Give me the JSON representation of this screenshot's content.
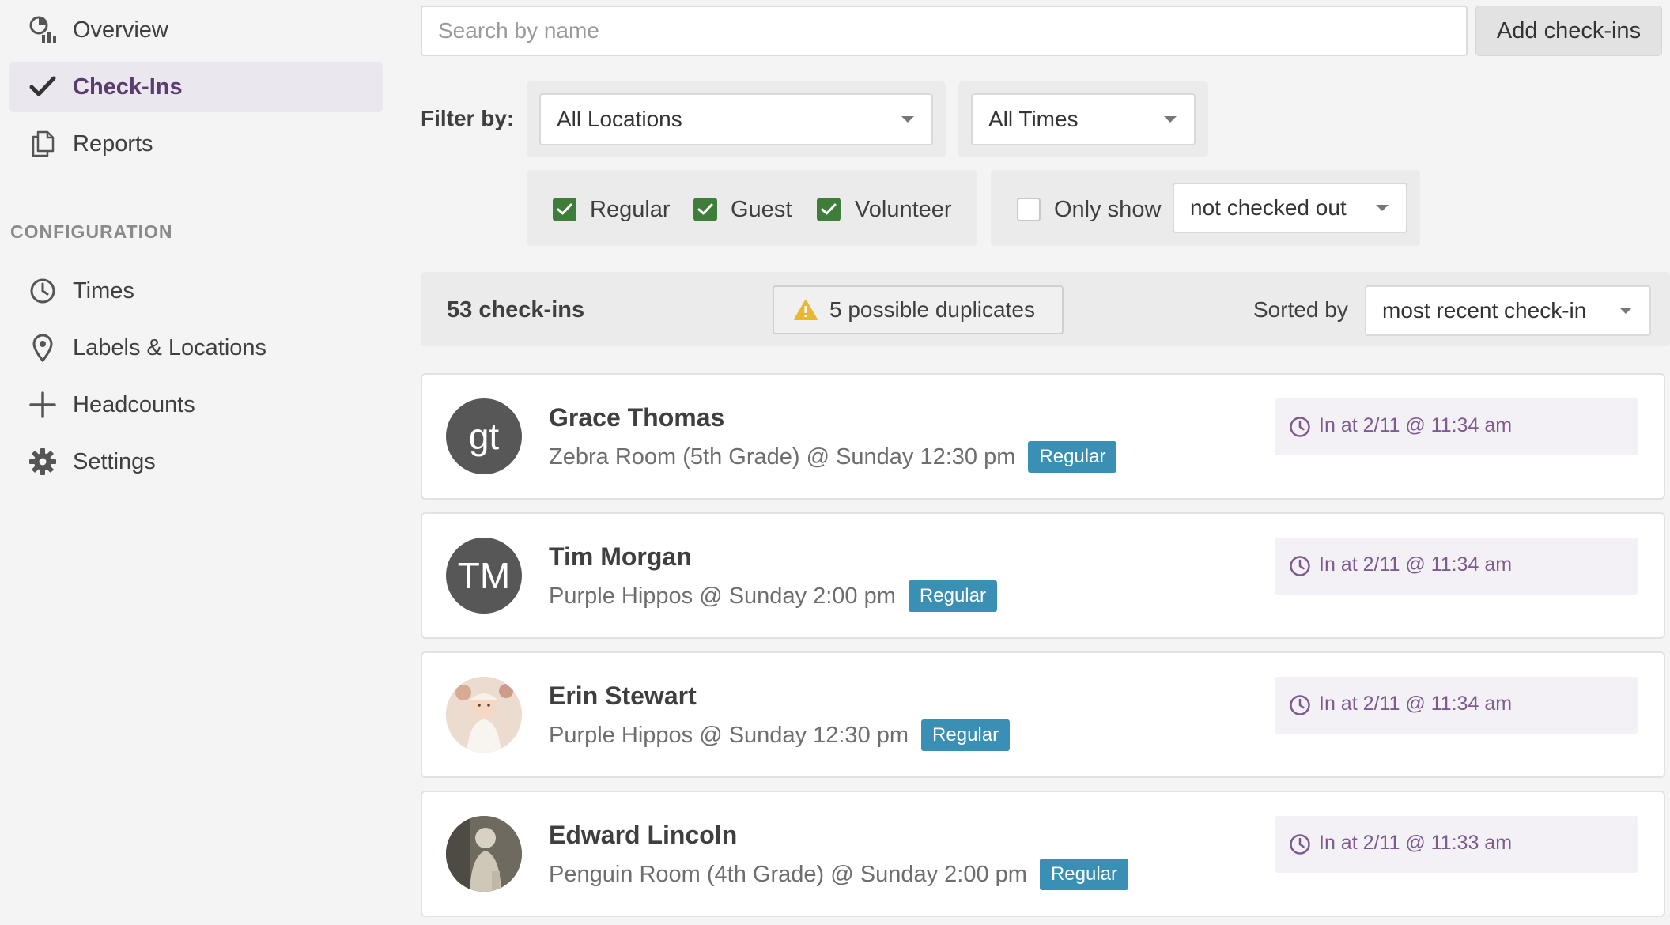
{
  "sidebar": {
    "items": [
      {
        "label": "Overview",
        "icon": "overview-icon",
        "active": false
      },
      {
        "label": "Check-Ins",
        "icon": "check-icon",
        "active": true
      },
      {
        "label": "Reports",
        "icon": "reports-icon",
        "active": false
      }
    ],
    "config_title": "CONFIGURATION",
    "config_items": [
      {
        "label": "Times",
        "icon": "clock-icon"
      },
      {
        "label": "Labels & Locations",
        "icon": "location-pin-icon"
      },
      {
        "label": "Headcounts",
        "icon": "plus-icon"
      },
      {
        "label": "Settings",
        "icon": "gear-icon"
      }
    ]
  },
  "search": {
    "placeholder": "Search by name",
    "value": ""
  },
  "add_button": "Add check-ins",
  "filters": {
    "label": "Filter by:",
    "location": "All Locations",
    "time": "All Times",
    "kinds": [
      {
        "label": "Regular",
        "checked": true
      },
      {
        "label": "Guest",
        "checked": true
      },
      {
        "label": "Volunteer",
        "checked": true
      }
    ],
    "only_show": {
      "label": "Only show",
      "checked": false,
      "value": "not checked out"
    }
  },
  "summary": {
    "count": "53 check-ins",
    "duplicates": "5 possible duplicates",
    "sorted_label": "Sorted by",
    "sorted_value": "most recent check-in"
  },
  "checkins": [
    {
      "name": "Grace Thomas",
      "initials": "gt",
      "avatar": "initials",
      "detail": "Zebra Room (5th Grade) @ Sunday 12:30 pm",
      "kind": "Regular",
      "time": "In at 2/11 @ 11:34 am"
    },
    {
      "name": "Tim Morgan",
      "initials": "TM",
      "avatar": "initials",
      "detail": "Purple Hippos @ Sunday 2:00 pm",
      "kind": "Regular",
      "time": "In at 2/11 @ 11:34 am"
    },
    {
      "name": "Erin Stewart",
      "initials": "",
      "avatar": "photo",
      "detail": "Purple Hippos @ Sunday 12:30 pm",
      "kind": "Regular",
      "time": "In at 2/11 @ 11:34 am"
    },
    {
      "name": "Edward Lincoln",
      "initials": "",
      "avatar": "photo",
      "detail": "Penguin Room (4th Grade) @ Sunday 2:00 pm",
      "kind": "Regular",
      "time": "In at 2/11 @ 11:33 am"
    }
  ],
  "colors": {
    "accent_purple": "#5b3c6e",
    "checkbox_green": "#3e7d3a",
    "badge_blue": "#3a8fb4",
    "warning_yellow": "#e8b82e"
  }
}
